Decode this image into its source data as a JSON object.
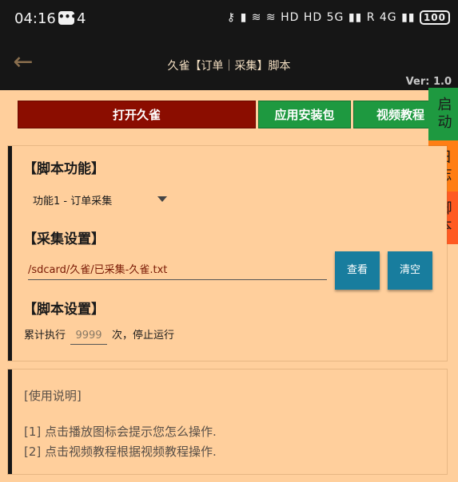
{
  "statusbar": {
    "time": "04:16",
    "notif_icon": "message-icon",
    "notif_count": "4",
    "icons_text": "⚷ ▮ ≋ ≋ HD HD 5G ▮▮ R 4G ▮▮",
    "battery": "100"
  },
  "appbar": {
    "title": "久雀【订单｜采集】脚本",
    "version": "Ver: 1.0"
  },
  "buttons": {
    "open": "打开久雀",
    "package": "应用安装包",
    "video": "视频教程"
  },
  "sidetabs": {
    "start": "启动",
    "log": "日志",
    "script": "脚本"
  },
  "script_card": {
    "function_header": "【脚本功能】",
    "function_selected": "功能1 - 订单采集",
    "collect_header": "【采集设置】",
    "path_value": "/sdcard/久雀/已采集-久雀.txt",
    "view_button": "查看",
    "clear_button": "清空",
    "settings_header": "【脚本设置】",
    "run_prefix": "累计执行",
    "run_count_placeholder": "9999",
    "run_suffix": "次，停止运行"
  },
  "help_card": {
    "title": "[使用说明]",
    "lines": [
      "[1] 点击播放图标会提示您怎么操作.",
      "[2] 点击视频教程根据视频教程操作."
    ]
  },
  "colors": {
    "background": "#ffcf9c",
    "topbar": "#161616",
    "open_button": "#8b0d00",
    "green_button": "#1e9940",
    "log_tab": "#ff7e14",
    "script_tab": "#ff5a22",
    "action_button": "#187d9e"
  }
}
